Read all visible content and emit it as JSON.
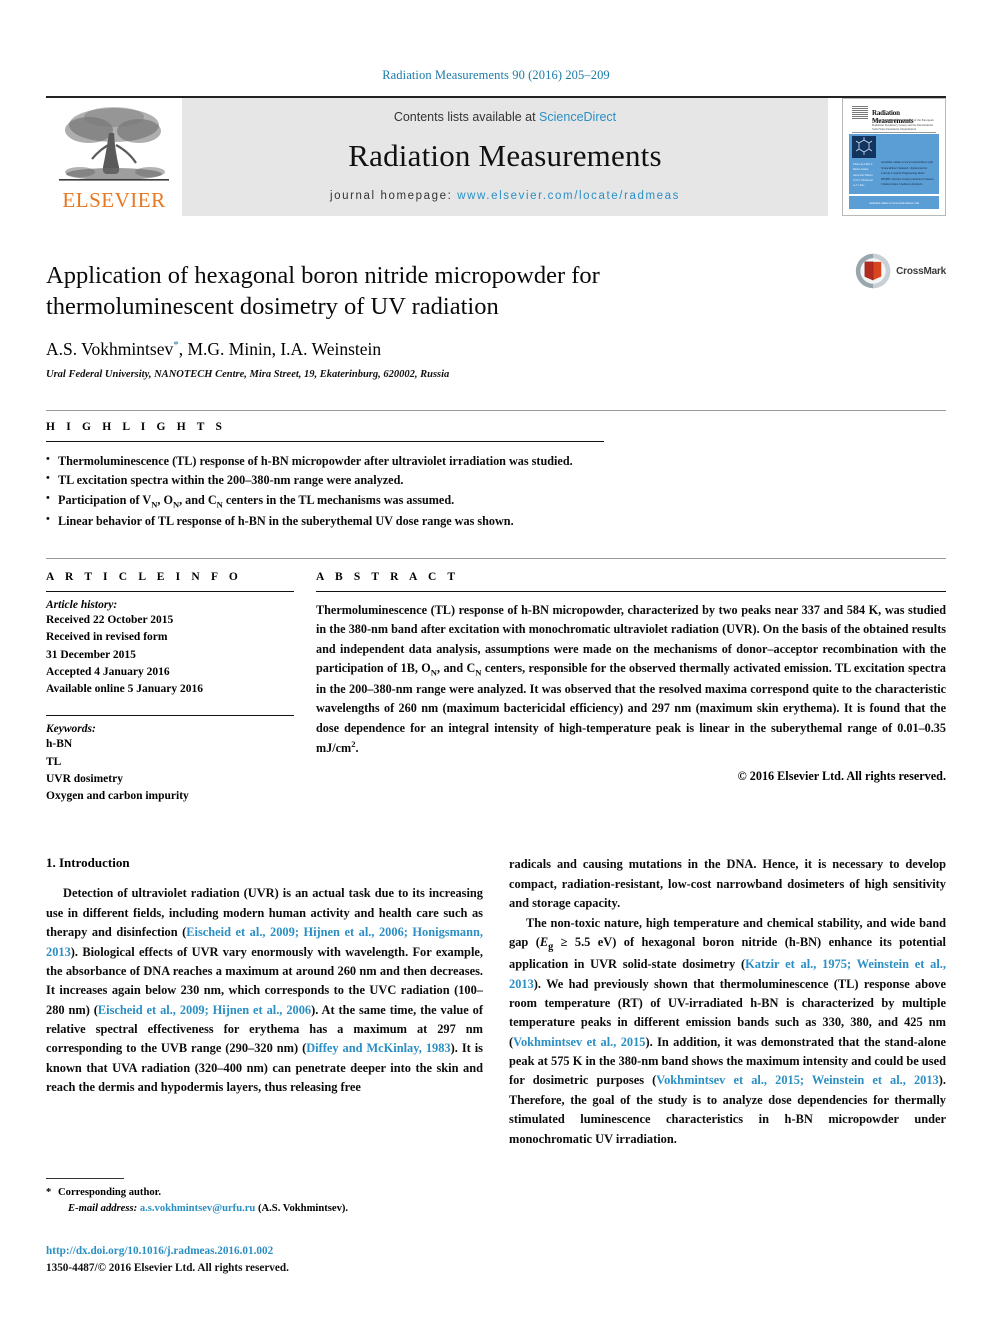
{
  "running_head": "Radiation Measurements 90 (2016) 205–209",
  "masthead": {
    "publisher_name": "ELSEVIER",
    "contents_prefix": "Contents lists available at ",
    "contents_link": "ScienceDirect",
    "journal_title": "Radiation Measurements",
    "homepage_prefix": "journal homepage: ",
    "homepage_url": "www.elsevier.com/locate/radmeas",
    "cover": {
      "title": "Radiation Measurements",
      "subtitle": "ISSN 1350-4487\nOfficial Journal of the European Radiation Dosimetry Group\nand the International Solid State Dosimetry Organization",
      "left_col": "Editor-in-Chief\nL. Bøtter-Jensen\n\nAssociate Editors\nS.W.S. McKeever\nA.J.J. Bos",
      "right_col": "Available online at\nwww.sciencedirect.com\nScienceDirect\nIndexed / Abstracted in:\nCurrent Contents\nEngineering Index\nINSPEC\nNuclear Science Abstracts\nScience Citation Index\nChemical Abstracts",
      "footer": "Available online at www.sciencedirect.com"
    }
  },
  "article": {
    "title": "Application of hexagonal boron nitride micropowder for thermoluminescent dosimetry of UV radiation",
    "authors": "A.S. Vokhmintsev*, M.G. Minin, I.A. Weinstein",
    "affiliation": "Ural Federal University, NANOTECH Centre, Mira Street, 19, Ekaterinburg, 620002, Russia",
    "crossmark_label": "CrossMark"
  },
  "highlights": {
    "label": "H I G H L I G H T S",
    "items": [
      "Thermoluminescence (TL) response of h-BN micropowder after ultraviolet irradiation was studied.",
      "TL excitation spectra within the 200–380-nm range were analyzed.",
      "Participation of V_N, O_N, and C_N centers in the TL mechanisms was assumed.",
      "Linear behavior of TL response of h-BN in the suberythemal UV dose range was shown."
    ]
  },
  "article_info": {
    "label": "A R T I C L E   I N F O",
    "history_label": "Article history:",
    "history": [
      "Received 22 October 2015",
      "Received in revised form",
      "31 December 2015",
      "Accepted 4 January 2016",
      "Available online 5 January 2016"
    ],
    "keywords_label": "Keywords:",
    "keywords": [
      "h-BN",
      "TL",
      "UVR dosimetry",
      "Oxygen and carbon impurity"
    ]
  },
  "abstract": {
    "label": "A B S T R A C T",
    "text": "Thermoluminescence (TL) response of h-BN micropowder, characterized by two peaks near 337 and 584 K, was studied in the 380-nm band after excitation with monochromatic ultraviolet radiation (UVR). On the basis of the obtained results and independent data analysis, assumptions were made on the mechanisms of donor–acceptor recombination with the participation of 1B, O_N, and C_N centers, responsible for the observed thermally activated emission. TL excitation spectra in the 200–380-nm range were analyzed. It was observed that the resolved maxima correspond quite to the characteristic wavelengths of 260 nm (maximum bactericidal efficiency) and 297 nm (maximum skin erythema). It is found that the dose dependence for an integral intensity of high-temperature peak is linear in the suberythemal range of 0.01–0.35 mJ/cm².",
    "copyright": "© 2016 Elsevier Ltd. All rights reserved."
  },
  "introduction": {
    "heading": "1. Introduction",
    "left_paragraph": "Detection of ultraviolet radiation (UVR) is an actual task due to its increasing use in different fields, including modern human activity and health care such as therapy and disinfection (Eischeid et al., 2009; Hijnen et al., 2006; Honigsmann, 2013). Biological effects of UVR vary enormously with wavelength. For example, the absorbance of DNA reaches a maximum at around 260 nm and then decreases. It increases again below 230 nm, which corresponds to the UVC radiation (100–280 nm) (Eischeid et al., 2009; Hijnen et al., 2006). At the same time, the value of relative spectral effectiveness for erythema has a maximum at 297 nm corresponding to the UVB range (290–320 nm) (Diffey and McKinlay, 1983). It is known that UVA radiation (320–400 nm) can penetrate deeper into the skin and reach the dermis and hypodermis layers, thus releasing free",
    "right_paragraph_1": "radicals and causing mutations in the DNA. Hence, it is necessary to develop compact, radiation-resistant, low-cost narrowband dosimeters of high sensitivity and storage capacity.",
    "right_paragraph_2": "The non-toxic nature, high temperature and chemical stability, and wide band gap (Eg ≥ 5.5 eV) of hexagonal boron nitride (h-BN) enhance its potential application in UVR solid-state dosimetry (Katzir et al., 1975; Weinstein et al., 2013). We had previously shown that thermoluminescence (TL) response above room temperature (RT) of UV-irradiated h-BN is characterized by multiple temperature peaks in different emission bands such as 330, 380, and 425 nm (Vokhmintsev et al., 2015). In addition, it was demonstrated that the stand-alone peak at 575 K in the 380-nm band shows the maximum intensity and could be used for dosimetric purposes (Vokhmintsev et al., 2015; Weinstein et al., 2013). Therefore, the goal of the study is to analyze dose dependencies for thermally stimulated luminescence characteristics in h-BN micropowder under monochromatic UV irradiation."
  },
  "footer": {
    "corresponding_author": "Corresponding author.",
    "email_label": "E-mail address:",
    "email": "a.s.vokhmintsev@urfu.ru",
    "email_owner": "(A.S. Vokhmintsev).",
    "doi": "http://dx.doi.org/10.1016/j.radmeas.2016.01.002",
    "issn_line": "1350-4487/© 2016 Elsevier Ltd. All rights reserved."
  },
  "colors": {
    "link": "#2b8fc4",
    "running_head": "#1b7ba8",
    "elsevier_orange": "#e87722",
    "band_bg": "#e6e6e6"
  }
}
